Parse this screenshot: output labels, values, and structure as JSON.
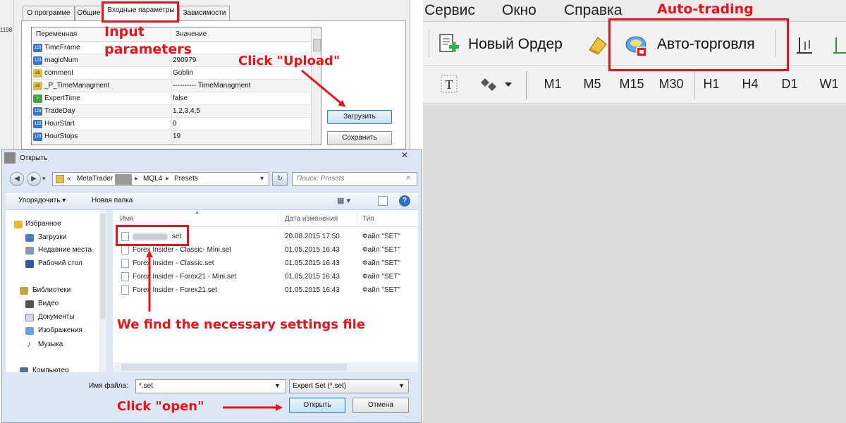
{
  "properties_dialog": {
    "left_number": "1198",
    "tabs": [
      "О программе",
      "Общие",
      "Входные параметры",
      "Зависимости"
    ],
    "grid_headers": {
      "variable": "Переменная",
      "value": "Значение"
    },
    "rows": [
      {
        "icon": "num",
        "icon_label": "123",
        "name": "TimeFrame",
        "value": ""
      },
      {
        "icon": "num",
        "icon_label": "123",
        "name": "magicNum",
        "value": "290979"
      },
      {
        "icon": "ab",
        "icon_label": "ab",
        "name": "comment",
        "value": "Goblin"
      },
      {
        "icon": "ab",
        "icon_label": "ab",
        "name": "_P_TimeManagment",
        "value": "---------- TimeManagment"
      },
      {
        "icon": "bool",
        "icon_label": "✓",
        "name": "ExpertTime",
        "value": "false"
      },
      {
        "icon": "num",
        "icon_label": "123",
        "name": "TradeDay",
        "value": "1,2,3,4,5"
      },
      {
        "icon": "num",
        "icon_label": "123",
        "name": "HourStart",
        "value": "0"
      },
      {
        "icon": "num",
        "icon_label": "123",
        "name": "HourStops",
        "value": "19"
      }
    ],
    "upload_button": "Загрузить",
    "save_button": "Сохранить"
  },
  "menubar": {
    "items": [
      "Сервис",
      "Окно",
      "Справка"
    ]
  },
  "toolbar": {
    "new_order": "Новый Ордер",
    "auto_trading": "Авто-торговля",
    "timeframes": [
      "M1",
      "M5",
      "M15",
      "M30",
      "H1",
      "H4",
      "D1",
      "W1"
    ]
  },
  "open_dialog": {
    "title": "Открыть",
    "address": {
      "prefix": "«",
      "part1": "MetaTrader",
      "part2": "MQL4",
      "part3": "Presets"
    },
    "search_placeholder": "Поиск: Presets",
    "organize": "Упорядочить ▾",
    "new_folder": "Новая папка",
    "nav": {
      "favorites": "Избранное",
      "downloads": "Загрузки",
      "recent": "Недавние места",
      "desktop": "Рабочий стол",
      "libraries": "Библиотеки",
      "video": "Видео",
      "documents": "Документы",
      "images": "Изображения",
      "music": "Музыка",
      "computer": "Компьютер"
    },
    "columns": {
      "name": "Имя",
      "date": "Дата изменения",
      "type": "Тип"
    },
    "files": [
      {
        "name": ".set",
        "date": "20.08.2015 17:50",
        "type": "Файл \"SET\""
      },
      {
        "name": "Forex Insider - Classic- Mini.set",
        "date": "01.05.2015 16:43",
        "type": "Файл \"SET\""
      },
      {
        "name": "Forex Insider - Classic.set",
        "date": "01.05.2015 16:43",
        "type": "Файл \"SET\""
      },
      {
        "name": "Forex Insider - Forex21 - Mini.set",
        "date": "01.05.2015 16:43",
        "type": "Файл \"SET\""
      },
      {
        "name": "Forex Insider - Forex21.set",
        "date": "01.05.2015 16:43",
        "type": "Файл \"SET\""
      }
    ],
    "filename_label": "Имя файла:",
    "filename_value": "*.set",
    "filter_value": "Expert Set (*.set)",
    "open_button": "Открыть",
    "cancel_button": "Отмена"
  },
  "annotations": {
    "input_parameters": "Input\nparameters",
    "click_upload": "Click \"Upload\"",
    "auto_trading": "Auto-trading",
    "find_file": "We find the necessary settings file",
    "click_open": "Click \"open\"",
    "color": "#e8141c"
  }
}
